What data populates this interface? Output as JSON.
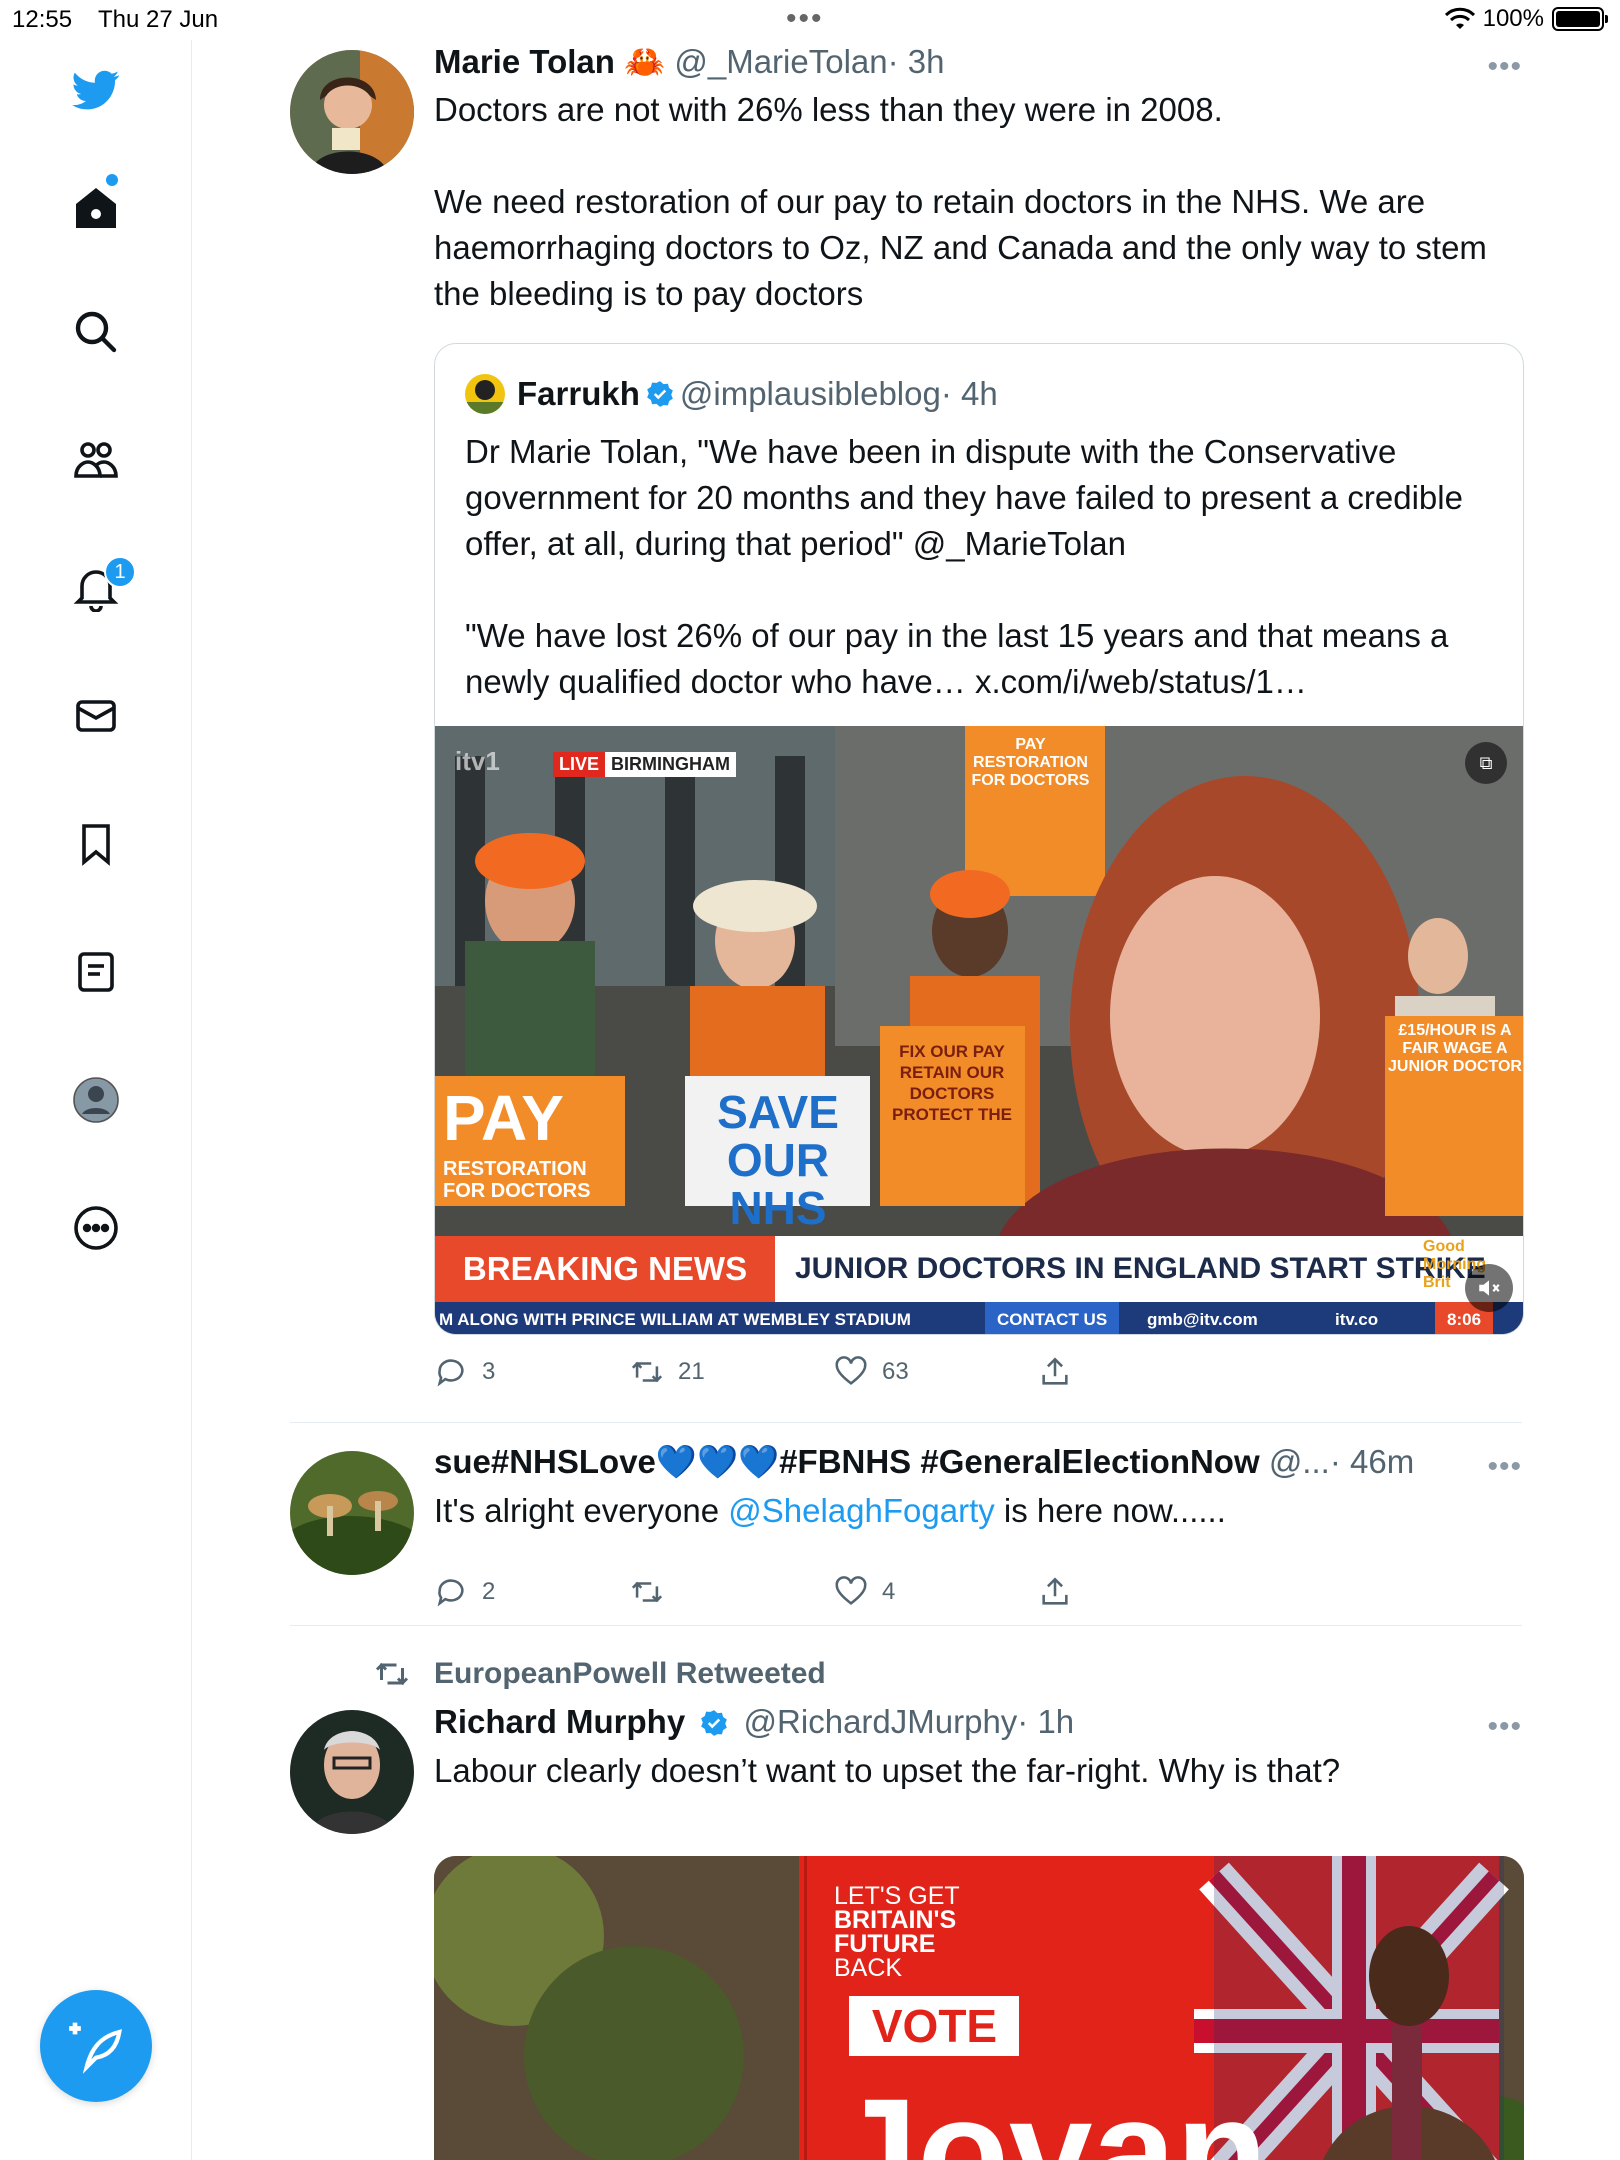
{
  "status_bar": {
    "time": "12:55",
    "date": "Thu 27 Jun",
    "battery": "100%"
  },
  "sidebar": {
    "items": [
      {
        "name": "home",
        "label": "Home"
      },
      {
        "name": "search",
        "label": "Explore"
      },
      {
        "name": "communities",
        "label": "Communities"
      },
      {
        "name": "notifications",
        "label": "Notifications"
      },
      {
        "name": "messages",
        "label": "Messages"
      },
      {
        "name": "bookmarks",
        "label": "Bookmarks"
      },
      {
        "name": "lists",
        "label": "Lists"
      },
      {
        "name": "profile",
        "label": "Profile"
      },
      {
        "name": "more",
        "label": "More"
      }
    ],
    "notification_count": "1",
    "brand_color": "#1d9bf0"
  },
  "tweets": [
    {
      "name": "Marie Tolan",
      "emoji": "🦀",
      "handle": "@_MarieTolan",
      "time": "· 3h",
      "text": "Doctors are not with 26% less than they were in 2008.\n\nWe need restoration of our pay to retain doctors in the NHS. We are haemorrhaging doctors to Oz, NZ and Canada and the only way to stem the bleeding is to pay doctors",
      "quote": {
        "name": "Farrukh",
        "handle": "@implausibleblog",
        "time": "· 4h",
        "text": "Dr Marie Tolan, \"We have been in dispute with the Conservative government for 20 months and they have failed to present a credible offer, at all, during that period\" @_MarieTolan\n\n\"We have lost 26% of our pay in the last 15 years and that means a newly qualified doctor who have… x.com/i/web/status/1…",
        "video": {
          "channel": "itv1",
          "live_label": "LIVE",
          "location": "BIRMINGHAM",
          "banner_left": "BREAKING NEWS",
          "banner_right": "JUNIOR DOCTORS IN ENGLAND START STRIKE",
          "ticker": "M ALONG WITH PRINCE WILLIAM AT WEMBLEY STADIUM",
          "ticker_contact": "CONTACT US",
          "ticker_email": "gmb@itv.com",
          "ticker_site": "itv.co",
          "show_logo": "Good Morning Brit",
          "clock": "8:06",
          "sign_pay": "PAY",
          "sign_pay_sub": "RESTORATION FOR DOCTORS",
          "sign_save": "SAVE OUR NHS",
          "sign_fix": "FIX OUR PAY RETAIN OUR DOCTORS PROTECT THE",
          "sign_wage": "£15/HOUR IS A FAIR WAGE A JUNIOR DOCTOR",
          "sign_top": "PAY RESTORATION FOR DOCTORS"
        }
      },
      "actions": {
        "replies": "3",
        "retweets": "21",
        "likes": "63"
      }
    },
    {
      "name": "sue#NHSLove💙💙💙#FBNHS #GeneralElectionNow",
      "handle": "@...",
      "time": "· 46m",
      "text_prefix": "It's alright everyone ",
      "mention": "@ShelaghFogarty",
      "text_suffix": " is here now......",
      "actions": {
        "replies": "2",
        "retweets": "",
        "likes": "4"
      }
    },
    {
      "retweeted_by": "EuropeanPowell Retweeted",
      "name": "Richard Murphy",
      "handle": "@RichardJMurphy",
      "time": "· 1h",
      "text": "Labour clearly doesn’t want to upset the far-right. Why is that?",
      "image": {
        "poster_line1": "LET'S GET",
        "poster_line2": "BRITAIN'S",
        "poster_line3": "FUTURE",
        "poster_line4": "BACK",
        "poster_vote": "VOTE",
        "poster_name": "Jovan"
      }
    }
  ]
}
